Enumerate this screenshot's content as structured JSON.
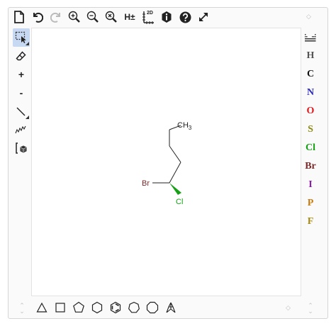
{
  "toolbar": {
    "tools": [
      {
        "name": "new-document",
        "icon": "document-icon"
      },
      {
        "name": "undo",
        "icon": "undo-icon"
      },
      {
        "name": "redo",
        "icon": "redo-icon"
      },
      {
        "name": "zoom-in",
        "icon": "zoom-in-icon"
      },
      {
        "name": "zoom-out",
        "icon": "zoom-out-icon"
      },
      {
        "name": "zoom-reset",
        "icon": "zoom-reset-icon"
      },
      {
        "name": "hydrogens",
        "icon": "hydrogen-toggle-icon",
        "label": "H±"
      },
      {
        "name": "clean-2d",
        "icon": "clean-2d-icon",
        "label": "2D"
      },
      {
        "name": "info",
        "icon": "info-icon"
      },
      {
        "name": "help",
        "icon": "help-icon"
      },
      {
        "name": "fullscreen",
        "icon": "fullscreen-icon"
      }
    ]
  },
  "left_tools": [
    {
      "name": "select",
      "icon": "selection-icon",
      "selected": true
    },
    {
      "name": "eraser",
      "icon": "eraser-icon"
    },
    {
      "name": "charge-plus",
      "icon": "plus-icon",
      "label": "+"
    },
    {
      "name": "charge-minus",
      "icon": "minus-icon",
      "label": "-"
    },
    {
      "name": "bond",
      "icon": "bond-line-icon"
    },
    {
      "name": "chain",
      "icon": "chain-icon"
    },
    {
      "name": "template",
      "icon": "template-icon"
    }
  ],
  "atoms": [
    {
      "symbol": "H",
      "color": "#555555"
    },
    {
      "symbol": "C",
      "color": "#111111"
    },
    {
      "symbol": "N",
      "color": "#2b2bb8"
    },
    {
      "symbol": "O",
      "color": "#e0161b"
    },
    {
      "symbol": "S",
      "color": "#8a8a10"
    },
    {
      "symbol": "Cl",
      "color": "#15a015"
    },
    {
      "symbol": "Br",
      "color": "#7a2a2a"
    },
    {
      "symbol": "I",
      "color": "#8a1fa8"
    },
    {
      "symbol": "P",
      "color": "#c87a10"
    },
    {
      "symbol": "F",
      "color": "#a88a10"
    }
  ],
  "rings": [
    "triangle",
    "square",
    "pentagon",
    "hexagon",
    "benzene",
    "heptagon",
    "octagon",
    "bicyclic"
  ],
  "molecule": {
    "ch3": "CH",
    "ch3_sub": "3",
    "br": "Br",
    "cl": "Cl",
    "br_color": "#7a2a2a",
    "cl_color": "#15a015"
  }
}
